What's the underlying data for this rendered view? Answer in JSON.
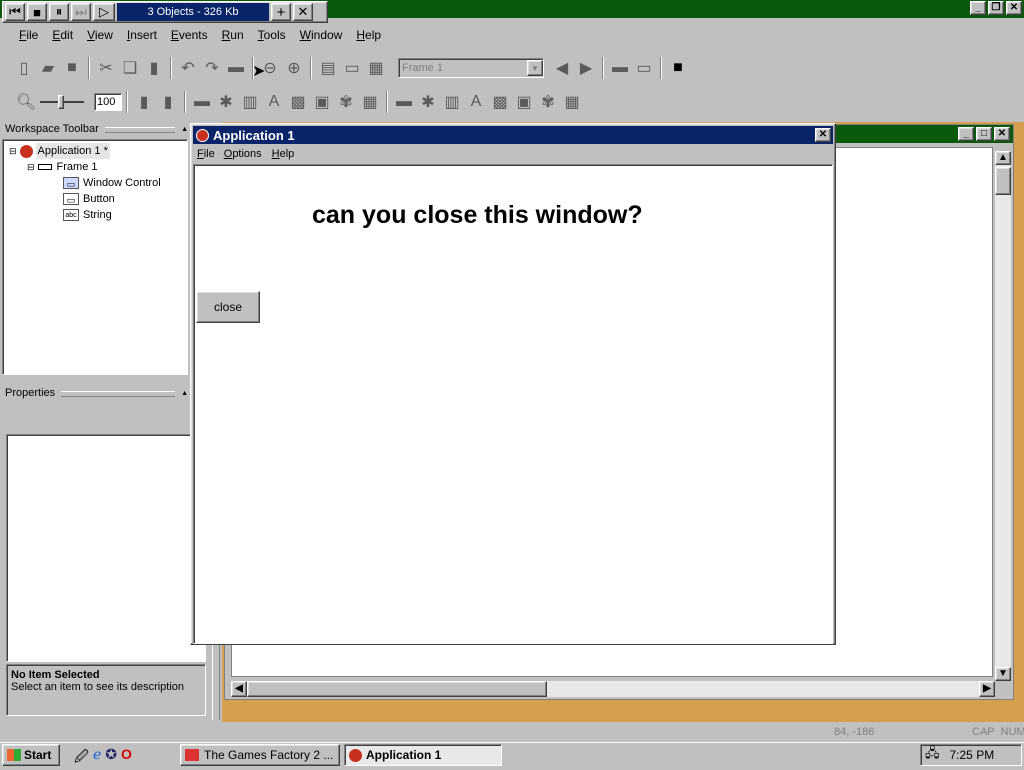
{
  "top_control": {
    "status": "3 Objects - 326 Kb",
    "plus": "+",
    "close": "✕"
  },
  "menubar": {
    "items": [
      "File",
      "Edit",
      "View",
      "Insert",
      "Events",
      "Run",
      "Tools",
      "Window",
      "Help"
    ]
  },
  "toolbar": {
    "frame_select": "Frame 1",
    "zoom_value": "100"
  },
  "workspace": {
    "title": "Workspace Toolbar",
    "tree": [
      {
        "label": "Application 1 *",
        "icon": "application-icon"
      },
      {
        "label": "Frame 1",
        "icon": "frame-icon"
      },
      {
        "label": "Window Control",
        "icon": "window-control-icon"
      },
      {
        "label": "Button",
        "icon": "button-object-icon"
      },
      {
        "label": "String",
        "icon": "string-object-icon"
      }
    ],
    "tree_icon_text": {
      "string": "abc"
    }
  },
  "properties": {
    "title": "Properties",
    "status_title": "No Item Selected",
    "status_desc": "Select an item to see its description"
  },
  "app_window": {
    "title": "Application 1",
    "menu": [
      "File",
      "Options",
      "Help"
    ],
    "heading": "can you close this window?",
    "button_label": "close"
  },
  "statusbar": {
    "coords": "84, -186",
    "indicators": "CAP  NUM"
  },
  "taskbar": {
    "start": "Start",
    "tasks": [
      {
        "label": "The Games Factory 2 ..."
      },
      {
        "label": "Application 1"
      }
    ],
    "clock": "7:25 PM"
  },
  "colors": {
    "titlebar": "#0a246a",
    "desktop_bar": "#0b5a0b",
    "tan": "#d4a050"
  }
}
